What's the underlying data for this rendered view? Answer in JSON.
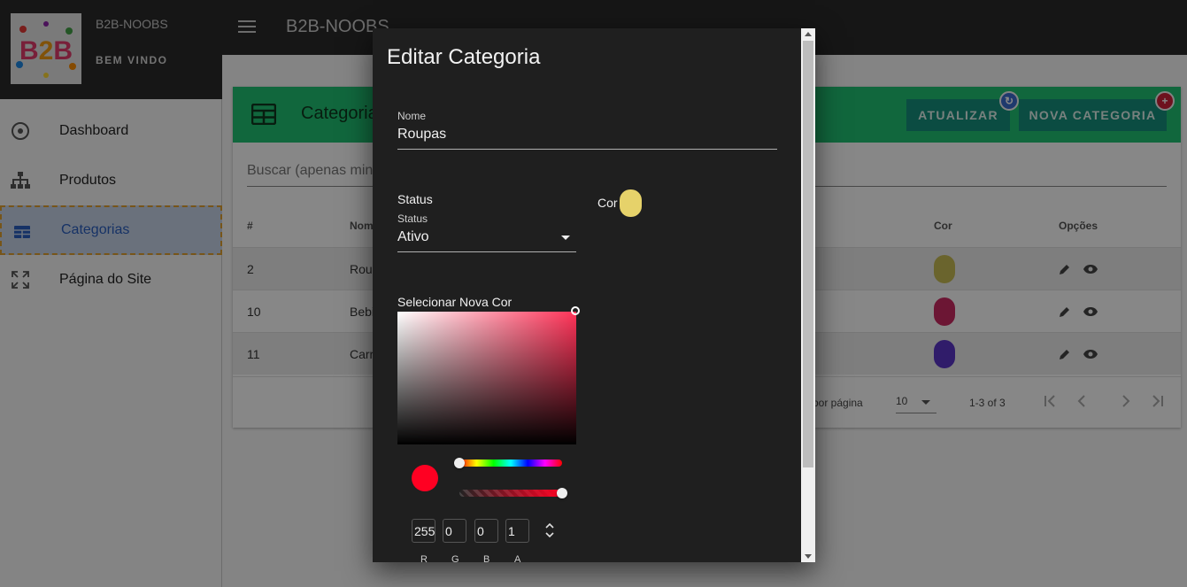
{
  "app": {
    "brand": "B2B-NOOBS",
    "welcome": "BEM VINDO",
    "logo_text": "B2B"
  },
  "sidebar": {
    "items": [
      {
        "label": "Dashboard",
        "icon": "dashboard-icon"
      },
      {
        "label": "Produtos",
        "icon": "sitemap-icon"
      },
      {
        "label": "Categorias",
        "icon": "table-icon",
        "active": true
      },
      {
        "label": "Página do Site",
        "icon": "expand-icon"
      }
    ]
  },
  "topbar": {
    "title": "B2B-NOOBS"
  },
  "card": {
    "title": "Categorias",
    "refresh_label": "ATUALIZAR",
    "new_label": "NOVA CATEGORIA",
    "search_placeholder": "Buscar (apenas min",
    "columns": {
      "id": "#",
      "name": "Nom",
      "color": "Cor",
      "options": "Opções"
    },
    "rows": [
      {
        "id": "2",
        "name": "Roup",
        "color": "#c9bd55"
      },
      {
        "id": "10",
        "name": "Bebi",
        "color": "#cc2a62"
      },
      {
        "id": "11",
        "name": "Carr",
        "color": "#5b36c9"
      }
    ],
    "footer": {
      "per_page_label": "por página",
      "per_page_value": "10",
      "range": "1-3 of 3"
    }
  },
  "dialog": {
    "title": "Editar Categoria",
    "name_label": "Nome",
    "name_value": "Roupas",
    "status_heading": "Status",
    "status_label": "Status",
    "status_value": "Ativo",
    "color_label": "Cor",
    "current_color": "#e6d26a",
    "picker_heading": "Selecionar Nova Cor",
    "picker_color": "#ff0022",
    "rgba": {
      "r": "255",
      "g": "0",
      "b": "0",
      "a": "1"
    },
    "rgba_labels": {
      "r": "R",
      "g": "G",
      "b": "B",
      "a": "A"
    }
  }
}
